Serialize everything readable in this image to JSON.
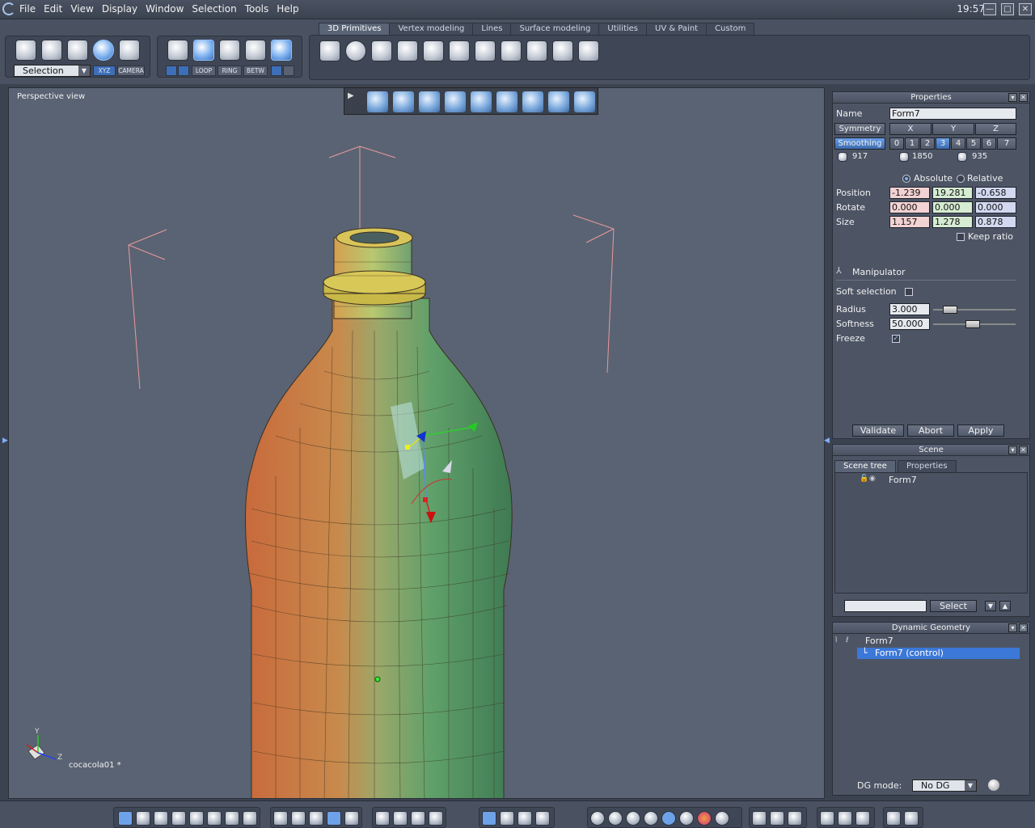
{
  "menubar": {
    "items": [
      "File",
      "Edit",
      "View",
      "Display",
      "Window",
      "Selection",
      "Tools",
      "Help"
    ],
    "clock": "19:57",
    "window_buttons": [
      "—",
      "□",
      "✕"
    ]
  },
  "toolbar": {
    "selection_label": "Selection",
    "xyz_label": "XYZ",
    "camera_label": "CAMERA",
    "small_buttons": [
      "LOOP",
      "RING",
      "BETW"
    ],
    "tabs": [
      "3D Primitives",
      "Vertex modeling",
      "Lines",
      "Surface modeling",
      "Utilities",
      "UV & Paint",
      "Custom"
    ],
    "active_tab": "3D Primitives"
  },
  "viewport": {
    "label": "Perspective view",
    "scene_name": "cocacola01 *",
    "axis_labels": {
      "y": "Y",
      "z": "Z"
    }
  },
  "properties": {
    "title": "Properties",
    "name_label": "Name",
    "name_value": "Form7",
    "symmetry_label": "Symmetry",
    "axes": [
      "X",
      "Y",
      "Z"
    ],
    "smoothing_label": "Smoothing",
    "smoothing_levels": [
      "0",
      "1",
      "2",
      "3",
      "4",
      "5",
      "6",
      "7"
    ],
    "smoothing_selected": "3",
    "counts": [
      "917",
      "1850",
      "935"
    ],
    "absolute_label": "Absolute",
    "relative_label": "Relative",
    "position_label": "Position",
    "position": [
      "-1.239",
      "19.281",
      "-0.658"
    ],
    "rotate_label": "Rotate",
    "rotate": [
      "0.000",
      "0.000",
      "0.000"
    ],
    "size_label": "Size",
    "size": [
      "1.157",
      "1.278",
      "0.878"
    ],
    "keep_ratio_label": "Keep ratio",
    "manipulator_label": "Manipulator",
    "soft_selection_label": "Soft selection",
    "radius_label": "Radius",
    "radius_value": "3.000",
    "softness_label": "Softness",
    "softness_value": "50.000",
    "freeze_label": "Freeze",
    "validate_label": "Validate",
    "abort_label": "Abort",
    "apply_label": "Apply"
  },
  "scene": {
    "title": "Scene",
    "tabs": [
      "Scene tree",
      "Properties"
    ],
    "active_tab": "Scene tree",
    "items": [
      "Form7"
    ],
    "search_value": "",
    "select_label": "Select"
  },
  "dynamic_geometry": {
    "title": "Dynamic Geometry",
    "items": [
      "Form7",
      "Form7 (control)"
    ],
    "selected_item": "Form7 (control)",
    "dg_mode_label": "DG mode:",
    "dg_mode_value": "No DG"
  }
}
